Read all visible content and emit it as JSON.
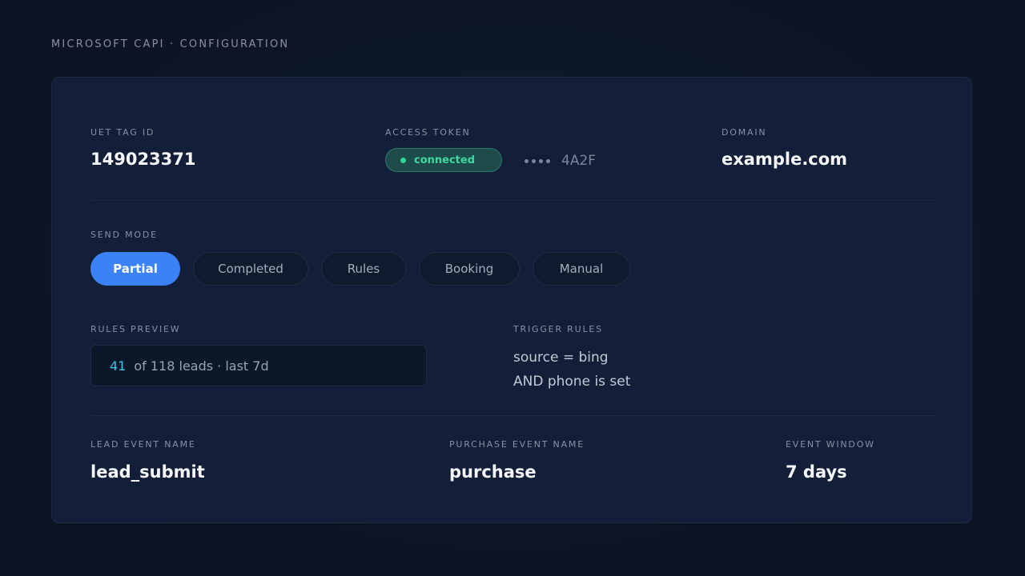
{
  "header": {
    "breadcrumb": "MICROSOFT CAPI · CONFIGURATION"
  },
  "config": {
    "uet_tag": {
      "label": "UET TAG ID",
      "value": "149023371"
    },
    "access_token": {
      "label": "ACCESS TOKEN",
      "status": "connected",
      "status_color": "#36d39a",
      "masked_suffix": "4A2F"
    },
    "domain": {
      "label": "DOMAIN",
      "value": "example.com"
    }
  },
  "send_mode": {
    "label": "SEND MODE",
    "selected": "Partial",
    "options": [
      "Partial",
      "Completed",
      "Rules",
      "Booking",
      "Manual"
    ],
    "accent_color": "#3b82f6"
  },
  "rules_preview": {
    "label": "RULES PREVIEW",
    "count": "41",
    "text": "of 118 leads · last 7d"
  },
  "trigger_rules": {
    "label": "TRIGGER RULES",
    "lines": [
      "source = bing",
      "AND phone is set"
    ]
  },
  "events": {
    "lead": {
      "label": "LEAD EVENT NAME",
      "value": "lead_submit"
    },
    "purchase": {
      "label": "PURCHASE EVENT NAME",
      "value": "purchase"
    },
    "window": {
      "label": "EVENT WINDOW",
      "value": "7 days"
    }
  }
}
